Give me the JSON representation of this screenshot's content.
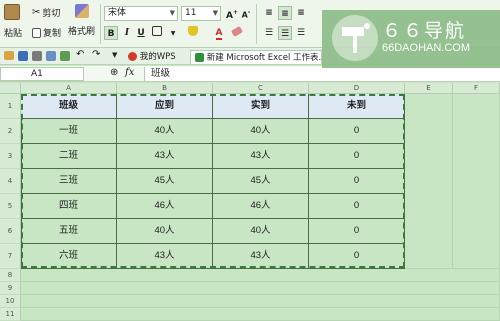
{
  "toolbar": {
    "paste_label": "粘贴",
    "cut_label": "剪切",
    "copy_label": "复制",
    "format_painter_label": "格式刷",
    "font_name": "宋体",
    "font_size": "11",
    "grow_font": "A",
    "shrink_font": "A",
    "bold": "B",
    "italic": "I",
    "underline": "U",
    "font_color_letter": "A"
  },
  "tabs": {
    "wps_home": "我的WPS",
    "document": "新建 Microsoft Excel 工作表.xlsx"
  },
  "formula_bar": {
    "cell_ref": "A1",
    "fx_label": "fx",
    "content": "班级"
  },
  "columns": [
    "A",
    "B",
    "C",
    "D",
    "E",
    "F"
  ],
  "rows": [
    "1",
    "2",
    "3",
    "4",
    "5",
    "6",
    "7",
    "8",
    "9",
    "10",
    "11"
  ],
  "table": {
    "header": [
      "班级",
      "应到",
      "实到",
      "未到"
    ],
    "body": [
      [
        "一班",
        "40人",
        "40人",
        "0"
      ],
      [
        "二班",
        "43人",
        "43人",
        "0"
      ],
      [
        "三班",
        "45人",
        "45人",
        "0"
      ],
      [
        "四班",
        "46人",
        "46人",
        "0"
      ],
      [
        "五班",
        "40人",
        "40人",
        "0"
      ],
      [
        "六班",
        "43人",
        "43人",
        "0"
      ]
    ]
  },
  "watermark": {
    "title": "６６导航",
    "subtitle": "66DAOHAN.COM"
  },
  "colors": {
    "sheet_background": "#c8e6c4",
    "header_fill": "#dfe9f4",
    "table_border": "#4c6b49",
    "selection_marquee": "#3a7a3a"
  }
}
